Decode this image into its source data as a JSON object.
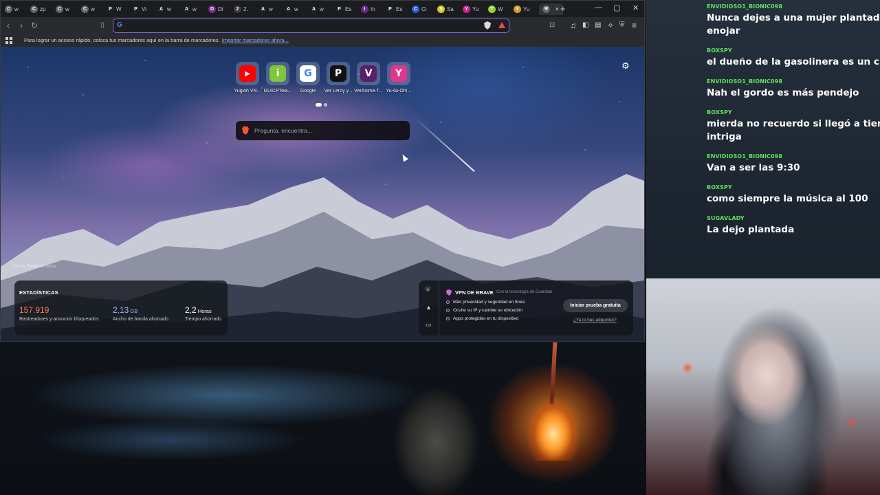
{
  "tabs": [
    {
      "icon_letter": "C",
      "icon_color": "#5f6368",
      "label": "w"
    },
    {
      "icon_letter": "C",
      "icon_color": "#5f6368",
      "label": "zp"
    },
    {
      "icon_letter": "C",
      "icon_color": "#5f6368",
      "label": "w"
    },
    {
      "icon_letter": "C",
      "icon_color": "#5f6368",
      "label": "w"
    },
    {
      "icon_letter": "P",
      "icon_color": "#202124",
      "label": "W"
    },
    {
      "icon_letter": "P",
      "icon_color": "#202124",
      "label": "Vi"
    },
    {
      "icon_letter": "A",
      "icon_color": "#202124",
      "label": "w"
    },
    {
      "icon_letter": "A",
      "icon_color": "#202124",
      "label": "w"
    },
    {
      "icon_letter": "D",
      "icon_color": "#7b2a8c",
      "label": "Di"
    },
    {
      "icon_letter": "2",
      "icon_color": "#3c3c3c",
      "label": "2."
    },
    {
      "icon_letter": "A",
      "icon_color": "#202124",
      "label": "w"
    },
    {
      "icon_letter": "A",
      "icon_color": "#202124",
      "label": "w"
    },
    {
      "icon_letter": "A",
      "icon_color": "#202124",
      "label": "w"
    },
    {
      "icon_letter": "P",
      "icon_color": "#202124",
      "label": "Es"
    },
    {
      "icon_letter": "I",
      "icon_color": "#6a2a8a",
      "label": "In"
    },
    {
      "icon_letter": "P",
      "icon_color": "#202124",
      "label": "Es"
    },
    {
      "icon_letter": "C",
      "icon_color": "#2a5ad8",
      "label": "Ci"
    },
    {
      "icon_letter": "S",
      "icon_color": "#d8c82a",
      "label": "Sa"
    },
    {
      "icon_letter": "Y",
      "icon_color": "#c4268a",
      "label": "Yu"
    },
    {
      "icon_letter": "T",
      "icon_color": "#9acd32",
      "label": "W"
    },
    {
      "icon_letter": "Y",
      "icon_color": "#d89a2a",
      "label": "Yu"
    }
  ],
  "active_tab": {
    "icon_name": "brave-shield-icon"
  },
  "window_controls": {
    "minimize": "—",
    "maximize": "▢",
    "close": "✕",
    "new_tab": "+"
  },
  "url_bar": {
    "value": "",
    "placeholder": ""
  },
  "bookmarks_bar": {
    "hint": "Para lograr un acceso rápido, coloca tus marcadores aquí en la barra de marcadores.",
    "import_link": "Importar marcadores ahora..."
  },
  "top_sites": [
    {
      "label": "Yugioh VR...",
      "glyph": "▶",
      "color": "#ff0000"
    },
    {
      "label": "GUICPTeia...",
      "glyph": "i",
      "color": "#7ec63a"
    },
    {
      "label": "Google",
      "glyph": "G",
      "color": "#ffffff"
    },
    {
      "label": "Ver Leroy y...",
      "glyph": "P",
      "color": "#111111"
    },
    {
      "label": "VerAnime.T...",
      "glyph": "V",
      "color": "#5a1f6a"
    },
    {
      "label": "Yu-Gi-Oh!...",
      "glyph": "Y",
      "color": "#e0368c"
    }
  ],
  "search": {
    "placeholder": "Pregunta, encuentra..."
  },
  "photo_credit": "Foto de Benjamin Voros",
  "stats": {
    "title": "ESTADÍSTICAS",
    "items": [
      {
        "value": "157.919",
        "unit": "",
        "label": "Rastreadores y anuncios bloqueados",
        "color": "#ff7a45"
      },
      {
        "value": "2,13",
        "unit": "GB",
        "label": "Ancho de banda ahorrado",
        "color": "#a8b4ff"
      },
      {
        "value": "2,2",
        "unit": "Horas",
        "label": "Tiempo ahorrado",
        "color": "#ffffff"
      }
    ]
  },
  "vpn": {
    "title": "VPN DE BRAVE",
    "tech": "Con la tecnología de Guardian",
    "features": [
      "Más privacidad y seguridad en línea",
      "Oculte su IP y cambie su ubicación",
      "Apps protegidas en tu dispositivo"
    ],
    "trial_button": "Iniciar prueba gratuita",
    "purchased_link": "¿Ya lo has adquirido?"
  },
  "chat": [
    {
      "user": "ENVIDIOSO1_BIONIC098",
      "text": "Nunca dejes a una mujer plantada porq",
      "text2": "enojar"
    },
    {
      "user": "BOXSPY",
      "text": "el dueño de la gasolinera es un chad",
      "text2": ""
    },
    {
      "user": "ENVIDIOSO1_BIONIC098",
      "text": "Nah el gordo es más pendejo",
      "text2": ""
    },
    {
      "user": "BOXSPY",
      "text": "mierda no recuerdo si llegó a tiempo, al",
      "text2": "intriga"
    },
    {
      "user": "ENVIDIOSO1_BIONIC098",
      "text": "Van a ser las 9:30",
      "text2": ""
    },
    {
      "user": "BOXSPY",
      "text": "como siempre la música al 100",
      "text2": ""
    },
    {
      "user": "SUGAVLADY",
      "text": "La dejo plantada",
      "text2": ""
    }
  ]
}
